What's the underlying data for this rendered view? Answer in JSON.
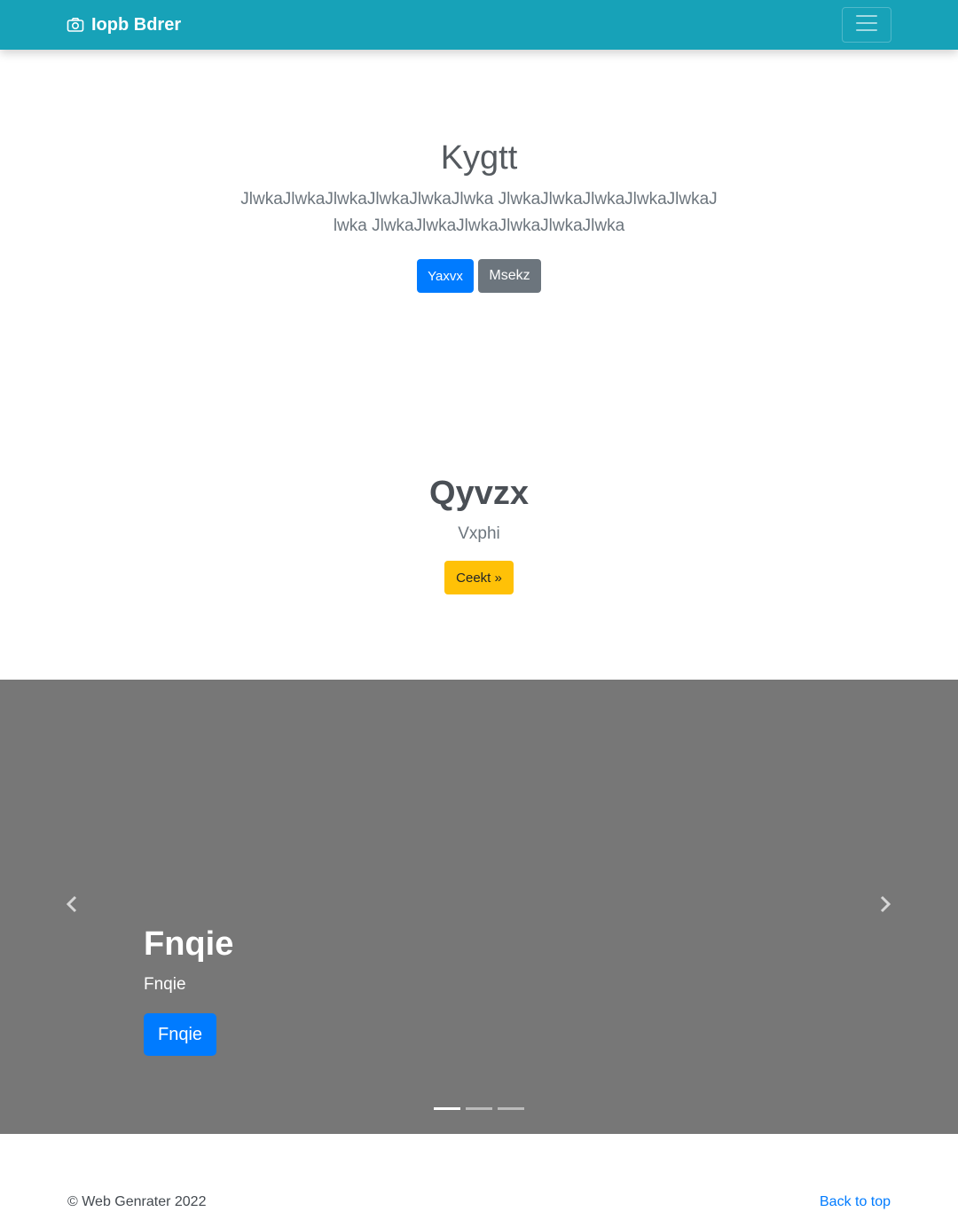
{
  "navbar": {
    "brand": "Iopb Bdrer",
    "brand_icon": "camera-icon",
    "toggler_icon": "hamburger-menu-icon",
    "background": "#17a2b8"
  },
  "hero": {
    "title": "Kygtt",
    "lead": "JlwkaJlwkaJlwkaJlwkaJlwkaJlwka JlwkaJlwkaJlwkaJlwkaJlwkaJlwka JlwkaJlwkaJlwkaJlwkaJlwkaJlwka",
    "primary_button": "Yaxvx",
    "secondary_button": "Msekz"
  },
  "feature": {
    "title": "Qyvzx",
    "subtitle": "Vxphi",
    "button": "Ceekt »"
  },
  "carousel": {
    "background": "#777777",
    "prev_icon": "chevron-left-icon",
    "next_icon": "chevron-right-icon",
    "slide": {
      "title": "Fnqie",
      "text": "Fnqie",
      "button": "Fnqie"
    },
    "indicators": [
      true,
      false,
      false
    ]
  },
  "footer": {
    "copyright": "© Web Genrater 2022",
    "back_to_top": "Back to top"
  },
  "colors": {
    "primary": "#007bff",
    "secondary": "#6c757d",
    "warning": "#ffc107"
  }
}
